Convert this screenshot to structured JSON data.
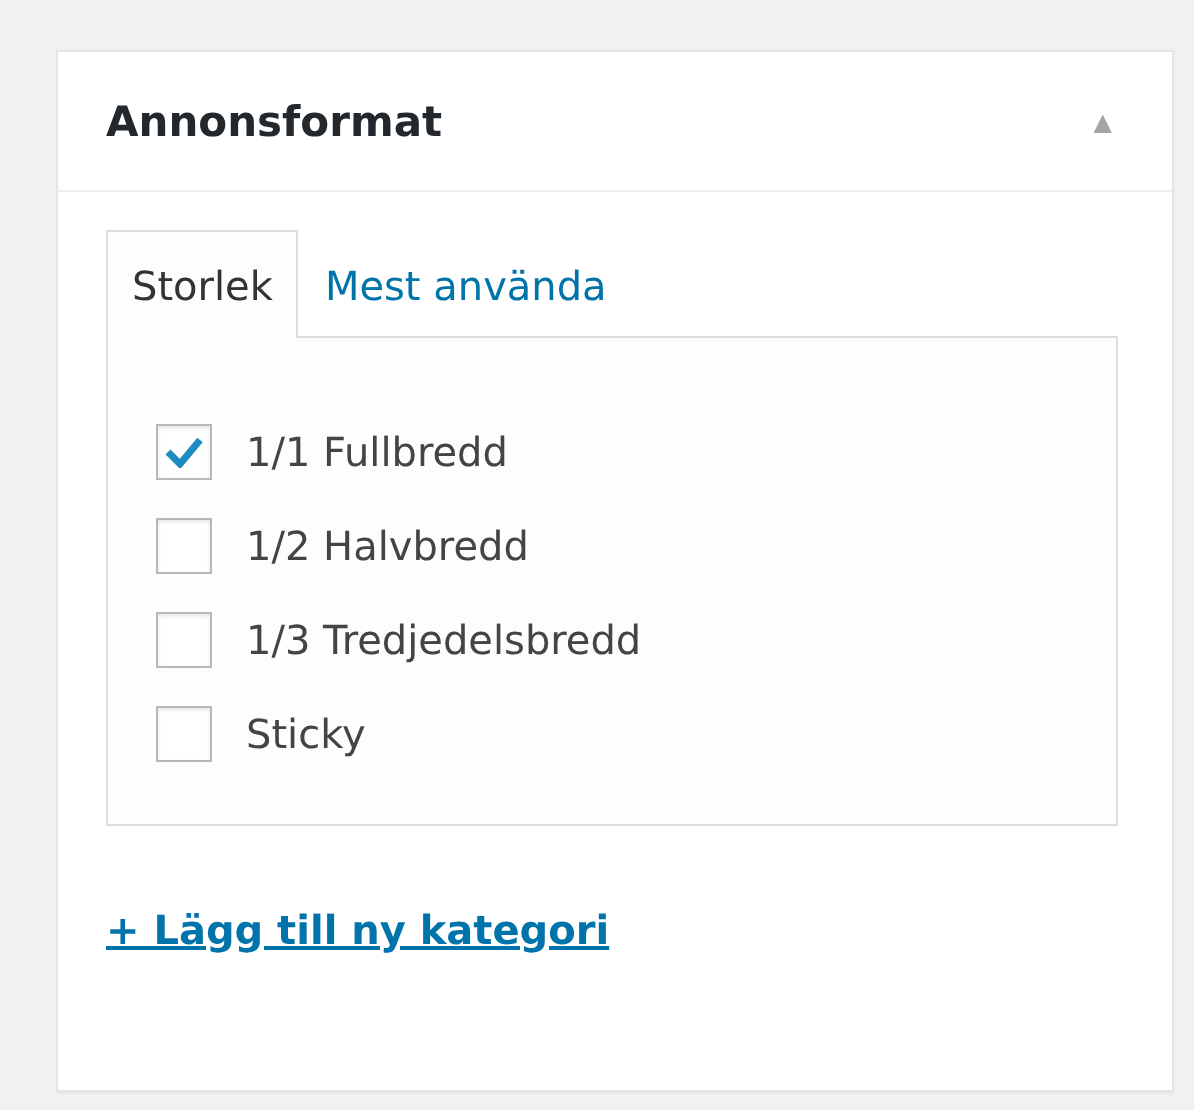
{
  "panel": {
    "title": "Annonsformat",
    "collapse_icon": "▲"
  },
  "tabs": [
    {
      "label": "Storlek",
      "selected": true
    },
    {
      "label": "Mest använda",
      "selected": false
    }
  ],
  "categories": [
    {
      "label": "1/1 Fullbredd",
      "checked": true
    },
    {
      "label": "1/2 Halvbredd",
      "checked": false
    },
    {
      "label": "1/3 Tredjedelsbredd",
      "checked": false
    },
    {
      "label": "Sticky",
      "checked": false
    }
  ],
  "add_link": "+ Lägg till ny kategori"
}
